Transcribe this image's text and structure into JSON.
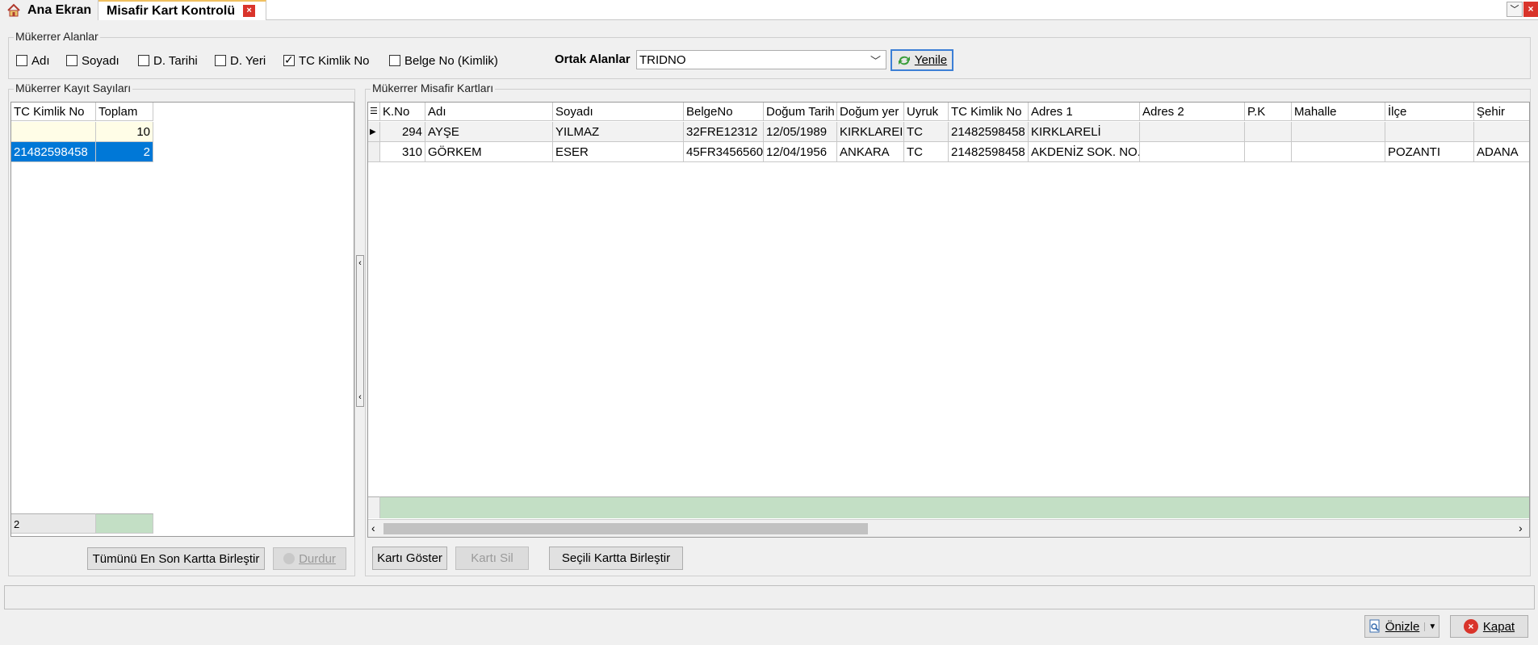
{
  "tabs": {
    "home_label": "Ana Ekran",
    "active_label": "Misafir Kart Kontrolü"
  },
  "filter_group": {
    "title": "Mükerrer Alanlar",
    "checkboxes": [
      {
        "label": "Adı",
        "checked": false
      },
      {
        "label": "Soyadı",
        "checked": false
      },
      {
        "label": "D. Tarihi",
        "checked": false
      },
      {
        "label": "D. Yeri",
        "checked": false
      },
      {
        "label": "TC Kimlik No",
        "checked": true
      },
      {
        "label": "Belge No (Kimlik)",
        "checked": false
      }
    ],
    "ortak_label": "Ortak Alanlar",
    "ortak_value": "TRIDNO",
    "yenile_label": "Yenile"
  },
  "left_panel": {
    "title": "Mükerrer Kayıt Sayıları",
    "columns": [
      "TC Kimlik No",
      "Toplam"
    ],
    "total_row": {
      "tc": "",
      "toplam": "10"
    },
    "rows": [
      {
        "tc": "21482598458",
        "toplam": "2"
      }
    ],
    "footer_count": "2",
    "merge_all_label": "Tümünü En Son Kartta Birleştir",
    "stop_label": "Durdur"
  },
  "right_panel": {
    "title": "Mükerrer Misafir Kartları",
    "columns": [
      "K.No",
      "Adı",
      "Soyadı",
      "BelgeNo",
      "Doğum Tarih",
      "Doğum yer",
      "Uyruk",
      "TC Kimlik No",
      "Adres 1",
      "Adres 2",
      "P.K",
      "Mahalle",
      "İlçe",
      "Şehir"
    ],
    "rows": [
      [
        "294",
        "AYŞE",
        "YILMAZ",
        "32FRE12312",
        "12/05/1989",
        "KIRKLAREI",
        "TC",
        "21482598458",
        "KIRKLARELİ",
        "",
        "",
        "",
        "",
        ""
      ],
      [
        "310",
        "GÖRKEM",
        "ESER",
        "45FR3456560",
        "12/04/1956",
        "ANKARA",
        "TC",
        "21482598458",
        "AKDENİZ SOK. NO.",
        "",
        "",
        "",
        "POZANTI",
        "ADANA"
      ]
    ],
    "show_card_label": "Kartı Göster",
    "delete_card_label": "Kartı Sil",
    "merge_selected_label": "Seçili Kartta Birleştir"
  },
  "footer": {
    "onizle_label": "Önizle",
    "kapat_label": "Kapat"
  },
  "colors": {
    "selection": "#0078d7",
    "total_row_bg": "#fffde7",
    "footer_green": "#c3dfc5",
    "accent_border": "#3c7fd6"
  }
}
